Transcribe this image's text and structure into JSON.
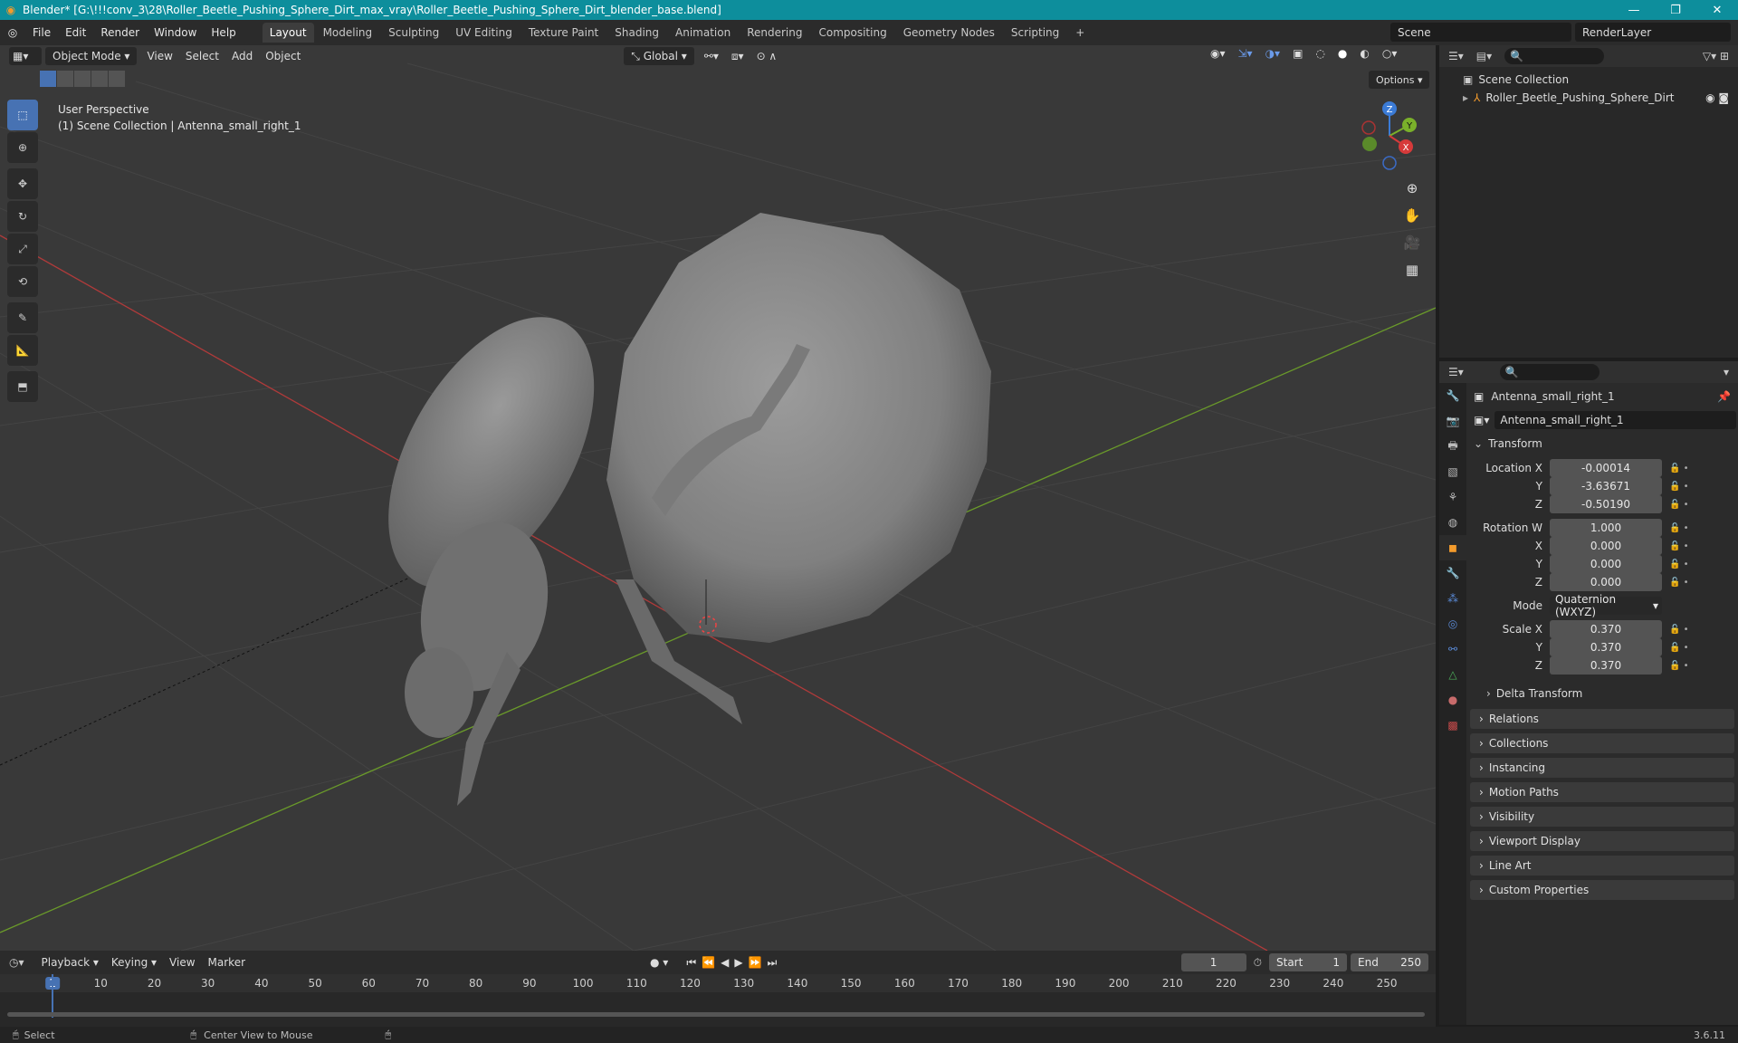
{
  "window": {
    "title": "Blender* [G:\\!!!conv_3\\28\\Roller_Beetle_Pushing_Sphere_Dirt_max_vray\\Roller_Beetle_Pushing_Sphere_Dirt_blender_base.blend]",
    "minimize": "—",
    "maximize": "❐",
    "close": "✕"
  },
  "menu": {
    "items": [
      "File",
      "Edit",
      "Render",
      "Window",
      "Help"
    ],
    "tabs": [
      "Layout",
      "Modeling",
      "Sculpting",
      "UV Editing",
      "Texture Paint",
      "Shading",
      "Animation",
      "Rendering",
      "Compositing",
      "Geometry Nodes",
      "Scripting"
    ],
    "add_tab": "+"
  },
  "scene": {
    "name": "Scene",
    "render_layer": "RenderLayer"
  },
  "viewport": {
    "mode": "Object Mode",
    "menus": [
      "View",
      "Select",
      "Add",
      "Object"
    ],
    "transform_orientation": "Global",
    "options": "Options",
    "perspective": "User Perspective",
    "collection_info": "(1) Scene Collection | Antenna_small_right_1",
    "gizmo": {
      "x": "X",
      "y": "Y",
      "z": "Z"
    }
  },
  "outliner": {
    "root": "Scene Collection",
    "object": "Roller_Beetle_Pushing_Sphere_Dirt"
  },
  "properties": {
    "object_name": "Antenna_small_right_1",
    "data_name": "Antenna_small_right_1",
    "transform_title": "Transform",
    "location": {
      "label": "Location X",
      "x": "-0.00014",
      "y": "-3.63671",
      "z": "-0.50190"
    },
    "rotation": {
      "label": "Rotation W",
      "w": "1.000",
      "x": "0.000",
      "y": "0.000",
      "z": "0.000"
    },
    "mode_label": "Mode",
    "mode_value": "Quaternion (WXYZ)",
    "scale": {
      "label": "Scale X",
      "x": "0.370",
      "y": "0.370",
      "z": "0.370"
    },
    "axis": {
      "y": "Y",
      "z": "Z",
      "x": "X"
    },
    "delta": "Delta Transform",
    "panels": [
      "Relations",
      "Collections",
      "Instancing",
      "Motion Paths",
      "Visibility",
      "Viewport Display",
      "Line Art",
      "Custom Properties"
    ]
  },
  "timeline": {
    "menus": [
      "Playback",
      "Keying",
      "View",
      "Marker"
    ],
    "current_frame": "1",
    "start_label": "Start",
    "start": "1",
    "end_label": "End",
    "end": "250",
    "ruler": [
      "1",
      "10",
      "20",
      "30",
      "40",
      "50",
      "60",
      "70",
      "80",
      "90",
      "100",
      "110",
      "120",
      "130",
      "140",
      "150",
      "160",
      "170",
      "180",
      "190",
      "200",
      "210",
      "220",
      "230",
      "240",
      "250"
    ]
  },
  "status": {
    "select": "Select",
    "center": "Center View to Mouse",
    "version": "3.6.11"
  }
}
